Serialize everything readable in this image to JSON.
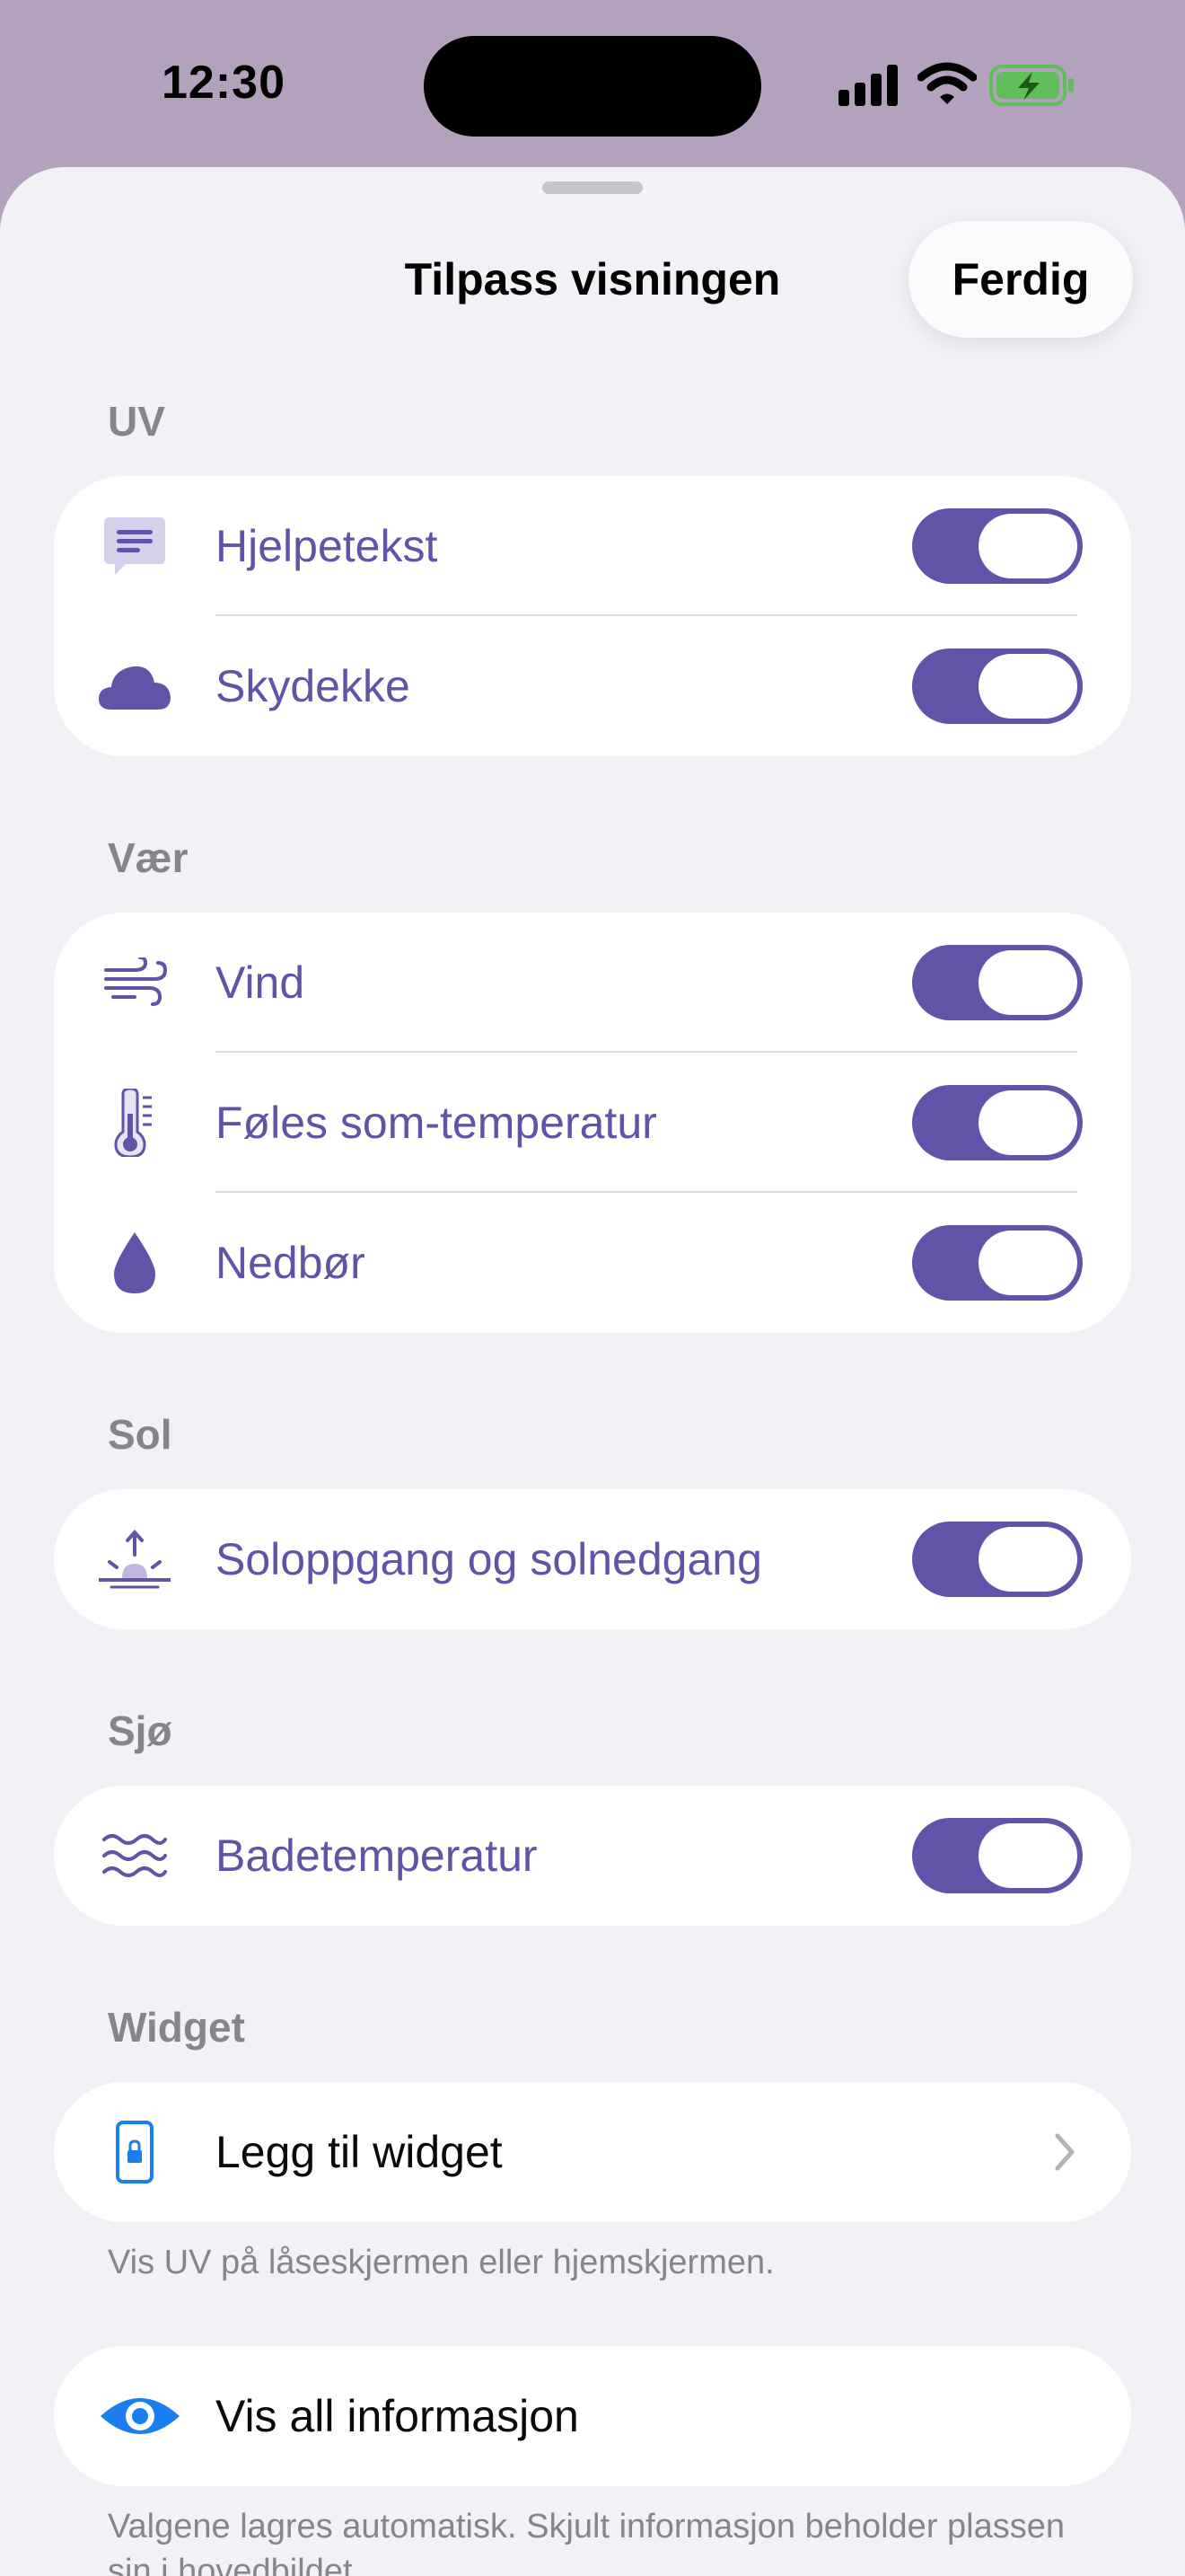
{
  "status_bar": {
    "time": "12:30"
  },
  "sheet": {
    "title": "Tilpass visningen",
    "done_label": "Ferdig"
  },
  "sections": {
    "uv": {
      "header": "UV",
      "items": [
        {
          "label": "Hjelpetekst",
          "icon": "text-bubble-icon",
          "enabled": true
        },
        {
          "label": "Skydekke",
          "icon": "cloud-icon",
          "enabled": true
        }
      ]
    },
    "weather": {
      "header": "Vær",
      "items": [
        {
          "label": "Vind",
          "icon": "wind-icon",
          "enabled": true
        },
        {
          "label": "Føles som-temperatur",
          "icon": "thermometer-icon",
          "enabled": true
        },
        {
          "label": "Nedbør",
          "icon": "raindrop-icon",
          "enabled": true
        }
      ]
    },
    "sun": {
      "header": "Sol",
      "items": [
        {
          "label": "Soloppgang og solnedgang",
          "icon": "sunrise-icon",
          "enabled": true
        }
      ]
    },
    "sea": {
      "header": "Sjø",
      "items": [
        {
          "label": "Badetemperatur",
          "icon": "waves-icon",
          "enabled": true
        }
      ]
    },
    "widget": {
      "header": "Widget",
      "add_label": "Legg til widget",
      "icon": "phone-lock-icon",
      "footnote": "Vis UV på låseskjermen eller hjemskjermen."
    },
    "all_info": {
      "label": "Vis all informasjon",
      "icon": "eye-icon",
      "footnote": "Valgene lagres automatisk. Skjult informasjon beholder plassen sin i hovedbildet."
    }
  },
  "colors": {
    "accent": "#6252a8",
    "link_blue": "#1a7ef0",
    "background": "#f2f1f6",
    "header_bg": "#b3a1bd"
  }
}
